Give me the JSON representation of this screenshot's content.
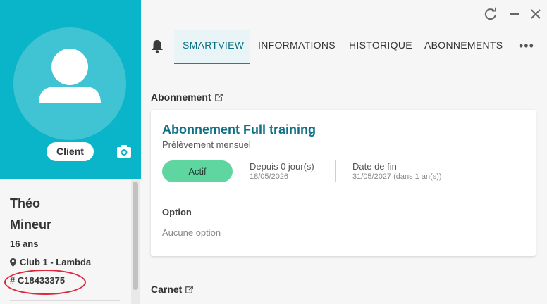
{
  "profile": {
    "badge": "Client",
    "first_name": "Théo",
    "last_name": "Mineur",
    "age": "16 ans",
    "club": "Club 1 - Lambda",
    "member_code": "# C18433375"
  },
  "tabs": [
    {
      "label": "SMARTVIEW",
      "active": true
    },
    {
      "label": "INFORMATIONS",
      "active": false
    },
    {
      "label": "HISTORIQUE",
      "active": false
    },
    {
      "label": "ABONNEMENTS",
      "active": false
    }
  ],
  "more_label": "•••",
  "subscription": {
    "section_title": "Abonnement",
    "name": "Abonnement Full training",
    "billing": "Prélèvement mensuel",
    "status": "Actif",
    "since_label": "Depuis 0 jour(s)",
    "since_date": "18/05/2026",
    "end_label": "Date de fin",
    "end_date": "31/05/2027 (dans 1 an(s))",
    "option_title": "Option",
    "option_value": "Aucune option"
  },
  "carnet": {
    "section_title": "Carnet"
  },
  "colors": {
    "accent": "#0bb5c9",
    "tab_active_text": "#0a6f84",
    "title_text": "#0f6f85",
    "status_green": "#5fd6a0",
    "highlight_red": "#e0263c"
  },
  "icons": [
    "refresh-icon",
    "minimize-icon",
    "close-icon",
    "bell-icon",
    "camera-icon",
    "location-pin-icon",
    "external-link-icon",
    "user-silhouette-icon"
  ]
}
